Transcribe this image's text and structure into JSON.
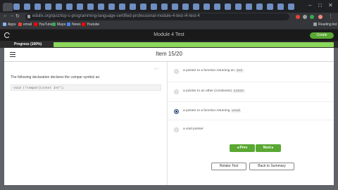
{
  "browser": {
    "url": "edulix.org/quiz/top-c-programming-language-certified-professional-module-4-test-/4-test-4",
    "bookmarks": [
      "Apps",
      "email",
      "YouTube",
      "Maps",
      "News",
      "Youtube"
    ],
    "reading_list": "Reading list",
    "colors": {
      "tab_icon": "#8ab4f8",
      "ext_red": "#ea4335",
      "ext_green": "#34a853"
    }
  },
  "header": {
    "title": "Module 4 Test",
    "create_label": "Create"
  },
  "progress": {
    "label": "Progress (100%)",
    "value": 100
  },
  "item": {
    "title": "Item 15/20"
  },
  "question": {
    "text": "The following declaration declares the compar symbol as:",
    "code": "void (*compar)(const int*);"
  },
  "options": [
    {
      "text": "a pointer to a function returning an",
      "code": "int",
      "selected": false
    },
    {
      "text": "a pointer to an other (constness)",
      "code": "const",
      "selected": false
    },
    {
      "text": "a pointer to a function returning",
      "code": "void",
      "selected": true
    },
    {
      "text": "a void pointer",
      "code": "",
      "selected": false
    }
  ],
  "nav": {
    "prev": "◂ Prev",
    "next": "Next ▸",
    "retake": "Retake Test",
    "back": "Back to Summary"
  },
  "colors": {
    "accent_green": "#5aa833",
    "progress_fill": "#8bd85a",
    "selected_radio": "#1f3b73"
  }
}
